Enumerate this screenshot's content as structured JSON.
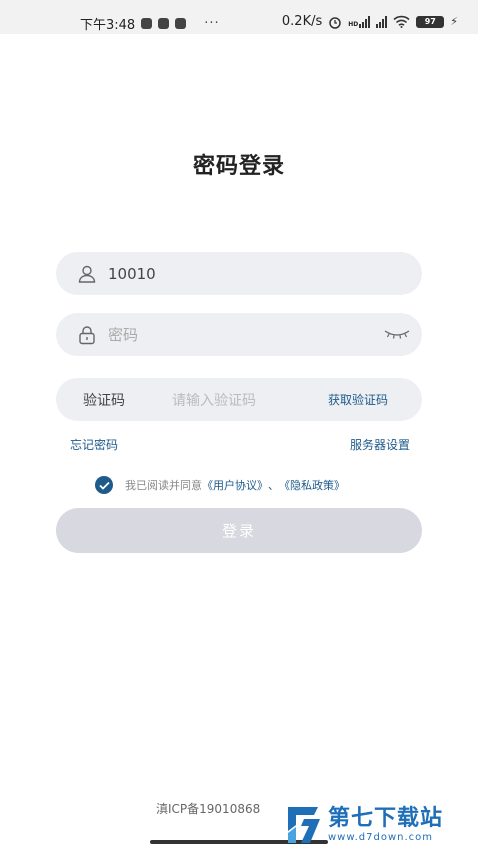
{
  "status_bar": {
    "time": "下午3:48",
    "dots": "···",
    "net_speed": "0.2K/s",
    "hd": "HD",
    "battery": "97"
  },
  "page": {
    "title": "密码登录"
  },
  "form": {
    "username_value": "10010",
    "password_placeholder": "密码",
    "code_label": "验证码",
    "code_placeholder": "请输入验证码",
    "get_code": "获取验证码",
    "forgot": "忘记密码",
    "server_settings": "服务器设置",
    "agree_prefix": "我已阅读并同意",
    "user_agreement": "《用户协议》",
    "separator": "、",
    "privacy_policy": "《隐私政策》",
    "login": "登录"
  },
  "footer": {
    "icp": "滇ICP备19010868"
  },
  "watermark": {
    "cn": "第七下载站",
    "en": "www.d7down.com"
  },
  "colors": {
    "accent": "#1e5a8a",
    "field_bg": "#eeeff3",
    "button_disabled": "#d7d8e0"
  }
}
